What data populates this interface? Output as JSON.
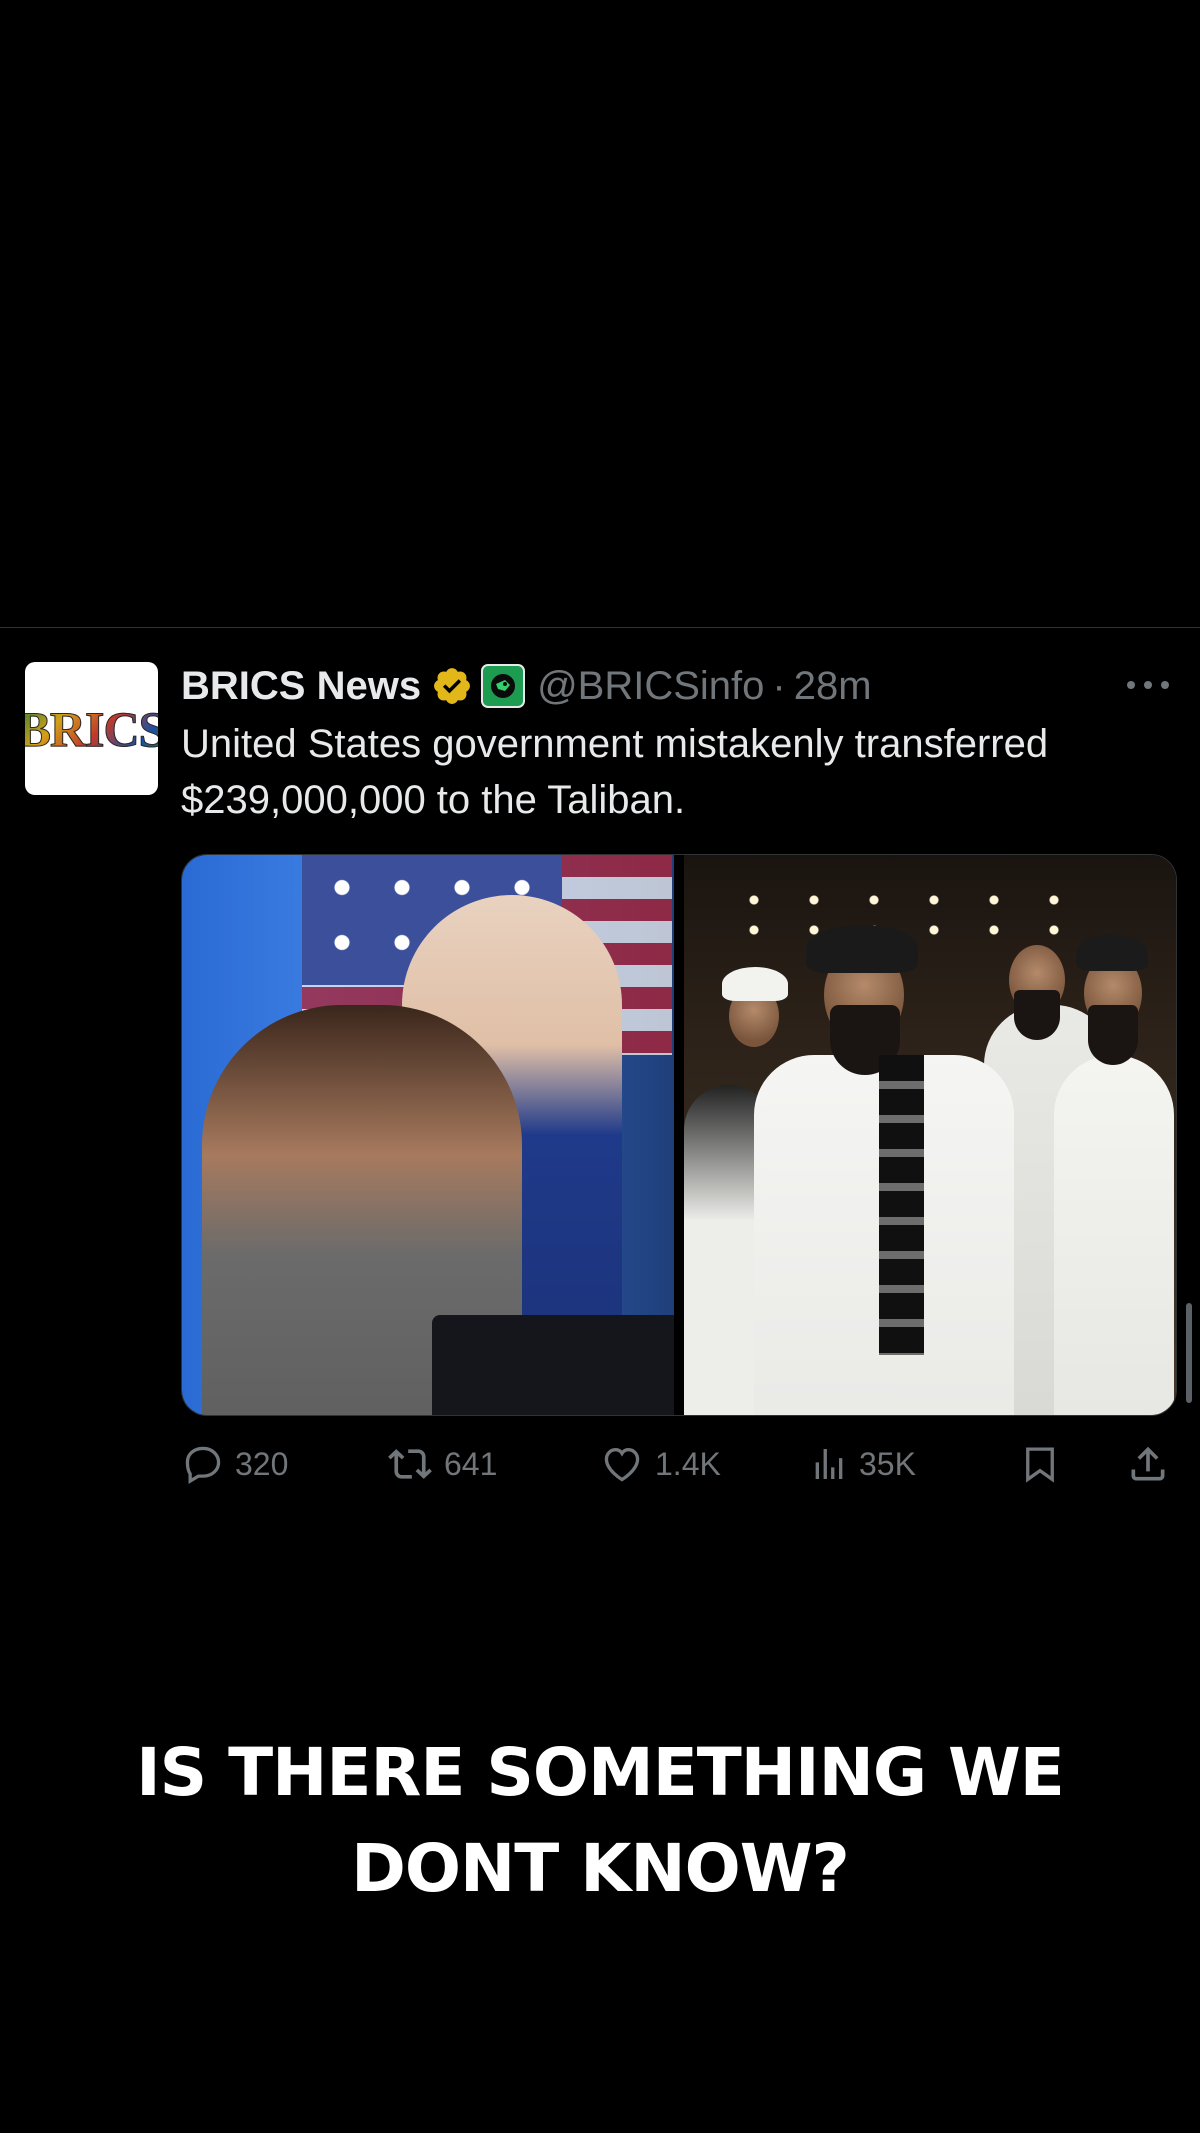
{
  "tweet": {
    "display_name": "BRICS News",
    "handle": "@BRICSinfo",
    "separator": "·",
    "time": "28m",
    "avatar_text": "BRICS",
    "text_line1": "United States government mistakenly transferred",
    "text_line2": "$239,000,000 to the Taliban.",
    "icons": {
      "verified": "verified-badge-icon",
      "affiliate": "affiliate-badge-icon",
      "more": "more-options-icon"
    },
    "media": {
      "images": [
        "photo-left",
        "photo-right"
      ]
    },
    "actions": {
      "replies": "320",
      "reposts": "641",
      "likes": "1.4K",
      "views": "35K"
    }
  },
  "caption": {
    "line1": "IS THERE SOMETHING WE",
    "line2": "DONT KNOW?"
  },
  "colors": {
    "background": "#000000",
    "text_primary": "#e7e9ea",
    "text_secondary": "#71767b",
    "verified_gold": "#e2b719",
    "divider": "#2f3336"
  }
}
